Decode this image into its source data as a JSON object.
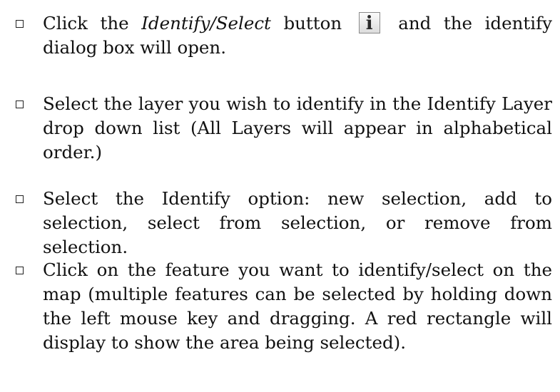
{
  "instructions": [
    {
      "pre": "Click the ",
      "em": "Identify/Select",
      "mid": " button",
      "icon": "info-i-icon",
      "icon_glyph": "i",
      "post": "and the identify dialog box will open."
    },
    {
      "text": "Select the layer you wish to identify in the Identify Layer drop down list (All Layers will appear in alphabetical order.)"
    },
    {
      "text": "Select the Identify option: new selection, add to selection, select from selection, or remove from selection."
    },
    {
      "text": "Click on the feature you want to identify/select on the map (multiple features can be selected by holding down the left mouse key and dragging. A red rectangle will display to show the area being selected)."
    }
  ]
}
